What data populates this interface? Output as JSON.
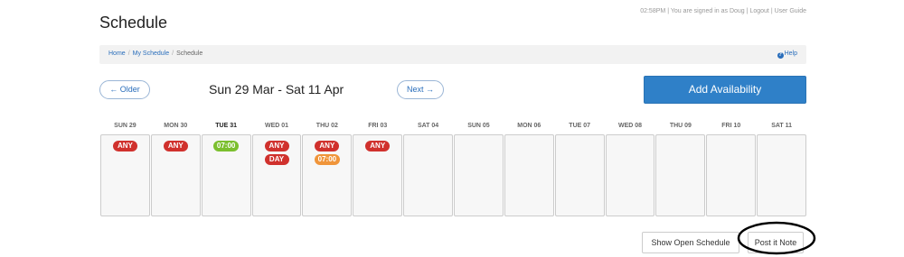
{
  "header": {
    "title": "Schedule",
    "time": "02:58PM",
    "signed_in_text": "You are signed in as Doug",
    "logout": "Logout",
    "user_guide": "User Guide",
    "sep": "|"
  },
  "breadcrumb": {
    "items": [
      "Home",
      "My Schedule",
      "Schedule"
    ],
    "sep": "/",
    "help": "Help"
  },
  "nav": {
    "older": "← Older",
    "range": "Sun 29 Mar - Sat 11 Apr",
    "next": "Next →",
    "add_availability": "Add Availability"
  },
  "colors": {
    "any": "#d0312d",
    "time_green": "#7bbf2e",
    "time_orange": "#f0953a",
    "primary": "#2f80c8"
  },
  "days": [
    {
      "label": "SUN 29",
      "today": false,
      "badges": [
        {
          "text": "ANY",
          "color": "red"
        }
      ]
    },
    {
      "label": "MON 30",
      "today": false,
      "badges": [
        {
          "text": "ANY",
          "color": "red"
        }
      ]
    },
    {
      "label": "TUE 31",
      "today": true,
      "badges": [
        {
          "text": "07:00",
          "color": "green"
        }
      ]
    },
    {
      "label": "WED 01",
      "today": false,
      "badges": [
        {
          "text": "ANY",
          "color": "red"
        },
        {
          "text": "DAY",
          "color": "red"
        }
      ]
    },
    {
      "label": "THU 02",
      "today": false,
      "badges": [
        {
          "text": "ANY",
          "color": "red"
        },
        {
          "text": "07:00",
          "color": "orange"
        }
      ]
    },
    {
      "label": "FRI 03",
      "today": false,
      "badges": [
        {
          "text": "ANY",
          "color": "red"
        }
      ]
    },
    {
      "label": "SAT 04",
      "today": false,
      "badges": []
    },
    {
      "label": "SUN 05",
      "today": false,
      "badges": []
    },
    {
      "label": "MON 06",
      "today": false,
      "badges": []
    },
    {
      "label": "TUE 07",
      "today": false,
      "badges": []
    },
    {
      "label": "WED 08",
      "today": false,
      "badges": []
    },
    {
      "label": "THU 09",
      "today": false,
      "badges": []
    },
    {
      "label": "FRI 10",
      "today": false,
      "badges": []
    },
    {
      "label": "SAT 11",
      "today": false,
      "badges": []
    }
  ],
  "footer": {
    "show_open_schedule": "Show Open Schedule",
    "post_it_note": "Post it Note"
  }
}
